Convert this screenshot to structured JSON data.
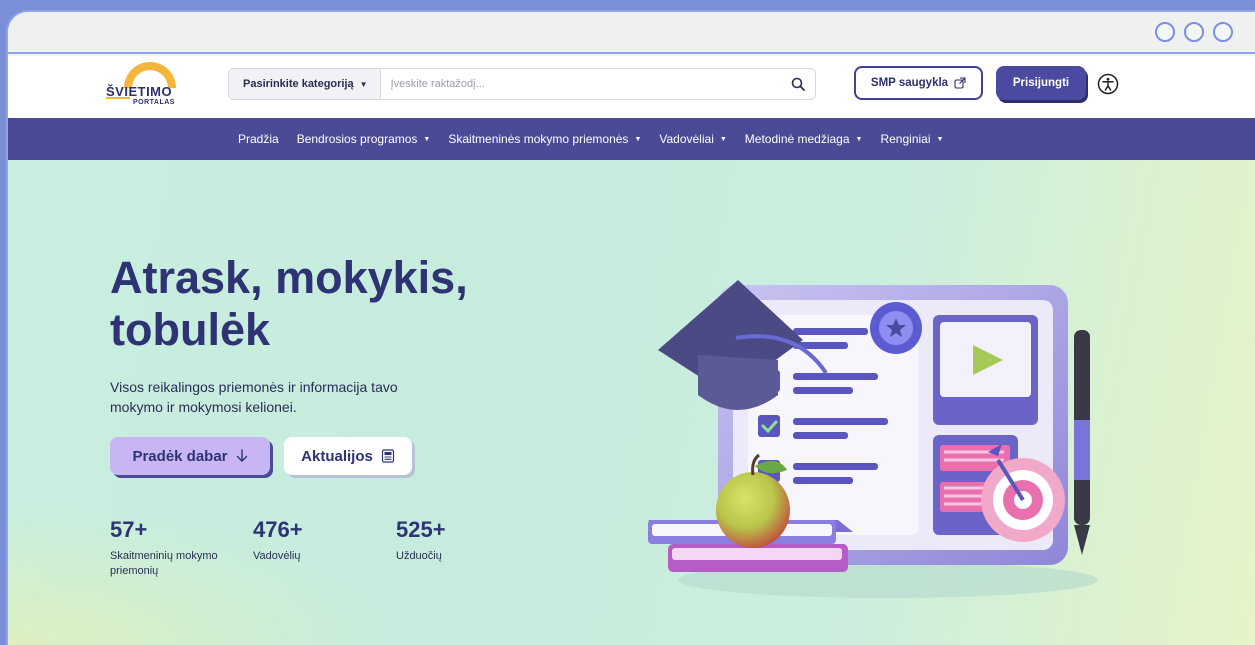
{
  "header": {
    "logo": {
      "line1": "ŠVIETIMO",
      "line2": "PORTALAS"
    },
    "search": {
      "category_label": "Pasirinkite kategoriją",
      "placeholder": "Įveskite raktažodį..."
    },
    "smp_button": "SMP saugykla",
    "login_button": "Prisijungti"
  },
  "nav": {
    "items": [
      {
        "label": "Pradžia",
        "dropdown": false
      },
      {
        "label": "Bendrosios programos",
        "dropdown": true
      },
      {
        "label": "Skaitmeninės mokymo priemonės",
        "dropdown": true
      },
      {
        "label": "Vadovėliai",
        "dropdown": true
      },
      {
        "label": "Metodinė medžiaga",
        "dropdown": true
      },
      {
        "label": "Renginiai",
        "dropdown": true
      }
    ]
  },
  "hero": {
    "title": "Atrask, mokykis, tobulėk",
    "subtitle": "Visos reikalingos priemonės ir informacija tavo mokymo ir mokymosi kelionei.",
    "start_button": "Pradėk dabar",
    "news_button": "Aktualijos",
    "stats": [
      {
        "value": "57+",
        "label": "Skaitmeninių mokymo priemonių"
      },
      {
        "value": "476+",
        "label": "Vadovėlių"
      },
      {
        "value": "525+",
        "label": "Užduočių"
      }
    ]
  },
  "colors": {
    "primary": "#4b4a97",
    "navy_text": "#2e3373",
    "accent_lavender": "#c8b6f4",
    "logo_orange": "#f3b53a"
  }
}
